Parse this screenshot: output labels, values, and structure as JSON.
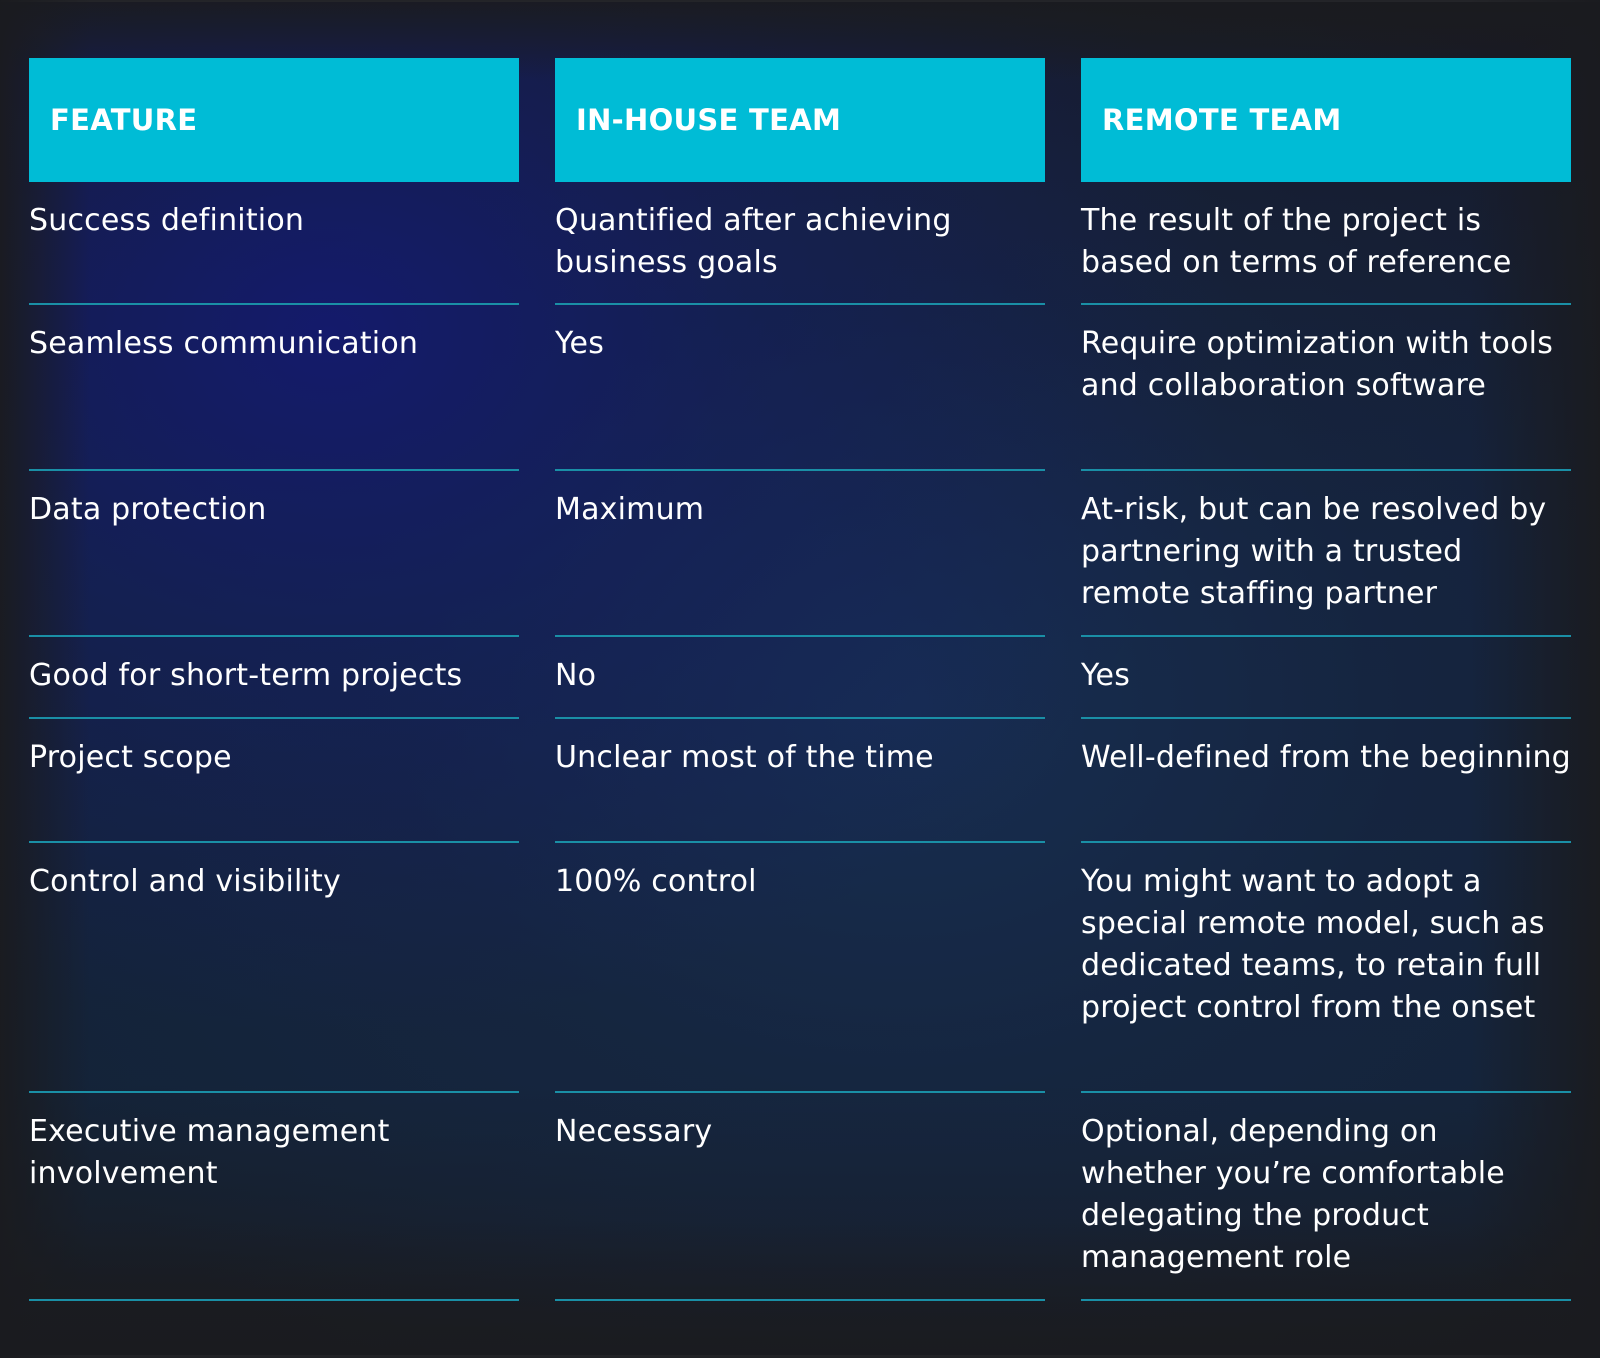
{
  "table": {
    "headers": [
      "FEATURE",
      "IN-HOUSE TEAM",
      "REMOTE TEAM"
    ],
    "rows": [
      {
        "feature": "Success definition",
        "in_house": "Quantified after achieving business goals",
        "remote": "The result of the project is based on terms of reference"
      },
      {
        "feature": "Seamless communication",
        "in_house": "Yes",
        "remote": "Require optimization with tools and collaboration software"
      },
      {
        "feature": "Data protection",
        "in_house": "Maximum",
        "remote": "At-risk, but can be resolved by partnering with a trusted remote staffing partner"
      },
      {
        "feature": "Good for short-term projects",
        "in_house": "No",
        "remote": "Yes"
      },
      {
        "feature": "Project scope",
        "in_house": "Unclear most of the time",
        "remote": "Well-defined from the beginning"
      },
      {
        "feature": "Control and visibility",
        "in_house": "100% control",
        "remote": "You might want to adopt a special remote model, such as dedicated teams, to retain full project control from the onset"
      },
      {
        "feature": "Executive management involvement",
        "in_house": "Necessary",
        "remote": "Optional, depending on whether you’re comfortable delegating the product management role"
      }
    ]
  },
  "colors": {
    "header_bg": "#00bcd6",
    "divider": "#1a8fa6",
    "text": "#ffffff",
    "background_dark": "#1a1b1f",
    "background_blue": "#141e6e"
  }
}
